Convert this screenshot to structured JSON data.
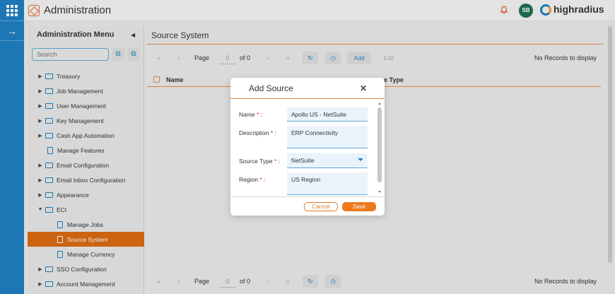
{
  "app": {
    "title": "Administration",
    "brand": "highradius",
    "user_initials": "SB"
  },
  "colors": {
    "rail": "#1f7fc0",
    "accent": "#ec7a1c",
    "active_item": "#d86a12"
  },
  "menu": {
    "heading": "Administration Menu",
    "search_placeholder": "Search",
    "items": [
      {
        "label": "Treasury",
        "type": "folder",
        "expanded": false
      },
      {
        "label": "Job Management",
        "type": "folder",
        "expanded": false
      },
      {
        "label": "User Management",
        "type": "folder",
        "expanded": false
      },
      {
        "label": "Key Management",
        "type": "folder",
        "expanded": false
      },
      {
        "label": "Cash App Automation",
        "type": "folder",
        "expanded": false
      },
      {
        "label": "Manage Features",
        "type": "page"
      },
      {
        "label": "Email Configuration",
        "type": "folder",
        "expanded": false
      },
      {
        "label": "Email Inbox Configuration",
        "type": "folder",
        "expanded": false
      },
      {
        "label": "Appearance",
        "type": "folder",
        "expanded": false
      },
      {
        "label": "ECI",
        "type": "folder",
        "expanded": true
      },
      {
        "label": "Manage Jobs",
        "type": "page",
        "child": true
      },
      {
        "label": "Source System",
        "type": "page",
        "child": true,
        "active": true
      },
      {
        "label": "Manage Currency",
        "type": "page",
        "child": true
      },
      {
        "label": "SSO Configuration",
        "type": "folder",
        "expanded": false
      },
      {
        "label": "Account Management",
        "type": "folder",
        "expanded": false
      }
    ]
  },
  "main": {
    "title": "Source System",
    "pager": {
      "page_label": "Page",
      "page_value": "0",
      "of_label": "of 0",
      "add_label": "Add",
      "edit_label": "Edit",
      "no_records": "No Records to display"
    },
    "columns": [
      "Name",
      "ce Type"
    ]
  },
  "modal": {
    "title": "Add Source",
    "fields": [
      {
        "label": "Name",
        "value": "Apollo US - NetSuite"
      },
      {
        "label": "Description",
        "value": "ERP Connectivity"
      },
      {
        "label": "Source Type",
        "value": "NetSuite"
      },
      {
        "label": "Region",
        "value": "US Region"
      }
    ],
    "cancel_label": "Cancel",
    "save_label": "Save"
  }
}
